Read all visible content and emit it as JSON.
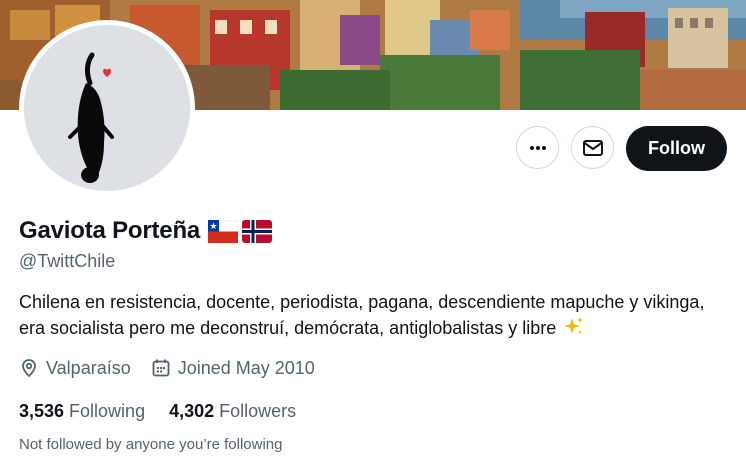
{
  "banner": {
    "icon": "valparaiso-hillside-photo"
  },
  "avatar": {
    "icon": "black-cat-with-heart-avatar"
  },
  "actions": {
    "more_icon": "more-horizontal-icon",
    "message_icon": "envelope-icon",
    "follow_label": "Follow"
  },
  "profile": {
    "display_name": "Gaviota Porteña",
    "flags": [
      "chile-flag-icon",
      "norway-flag-icon"
    ],
    "handle": "@TwittChile",
    "bio": "Chilena en resistencia, docente, periodista, pagana, descendiente mapuche y vikinga, era socialista pero me deconstruí, demócrata, antiglobalistas y libre",
    "bio_emoji": "sparkles-icon",
    "location": "Valparaíso",
    "joined": "Joined May 2010"
  },
  "stats": {
    "following_count": "3,536",
    "following_label": "Following",
    "followers_count": "4,302",
    "followers_label": "Followers"
  },
  "not_followed_text": "Not followed by anyone you’re following",
  "colors": {
    "text": "#0f1419",
    "secondary": "#536471",
    "follow_bg": "#0f1419",
    "border": "#cfd9de"
  }
}
